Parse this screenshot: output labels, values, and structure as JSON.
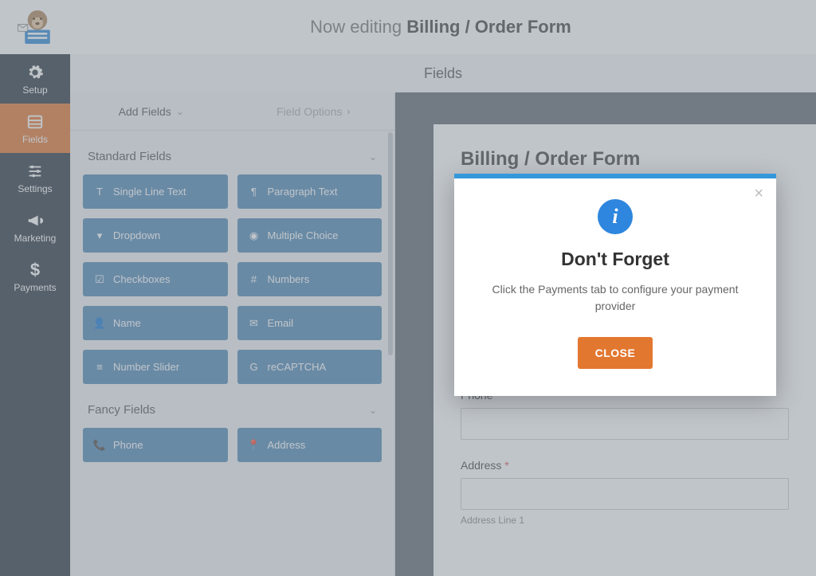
{
  "header": {
    "prefix": "Now editing ",
    "form_name": "Billing / Order Form"
  },
  "top_tab": "Fields",
  "sidebar": {
    "items": [
      {
        "label": "Setup",
        "icon": "gear-icon"
      },
      {
        "label": "Fields",
        "icon": "list-icon"
      },
      {
        "label": "Settings",
        "icon": "sliders-icon"
      },
      {
        "label": "Marketing",
        "icon": "bullhorn-icon"
      },
      {
        "label": "Payments",
        "icon": "dollar-icon"
      }
    ],
    "active_index": 1
  },
  "panel_tabs": {
    "add": "Add Fields",
    "options": "Field Options"
  },
  "sections": {
    "standard": {
      "title": "Standard Fields",
      "fields": [
        {
          "label": "Single Line Text",
          "icon": "text-icon"
        },
        {
          "label": "Paragraph Text",
          "icon": "paragraph-icon"
        },
        {
          "label": "Dropdown",
          "icon": "caret-square-icon"
        },
        {
          "label": "Multiple Choice",
          "icon": "dot-circle-icon"
        },
        {
          "label": "Checkboxes",
          "icon": "check-square-icon"
        },
        {
          "label": "Numbers",
          "icon": "hash-icon"
        },
        {
          "label": "Name",
          "icon": "user-icon"
        },
        {
          "label": "Email",
          "icon": "envelope-icon"
        },
        {
          "label": "Number Slider",
          "icon": "sliders2-icon"
        },
        {
          "label": "reCAPTCHA",
          "icon": "google-icon"
        }
      ]
    },
    "fancy": {
      "title": "Fancy Fields",
      "fields": [
        {
          "label": "Phone",
          "icon": "phone-icon"
        },
        {
          "label": "Address",
          "icon": "pin-icon"
        }
      ]
    }
  },
  "form": {
    "title": "Billing / Order Form",
    "phone_label": "Phone",
    "address_label": "Address",
    "address_sub": "Address Line 1",
    "required_marker": "*"
  },
  "modal": {
    "title": "Don't Forget",
    "text": "Click the Payments tab to configure your payment provider",
    "button": "CLOSE"
  }
}
